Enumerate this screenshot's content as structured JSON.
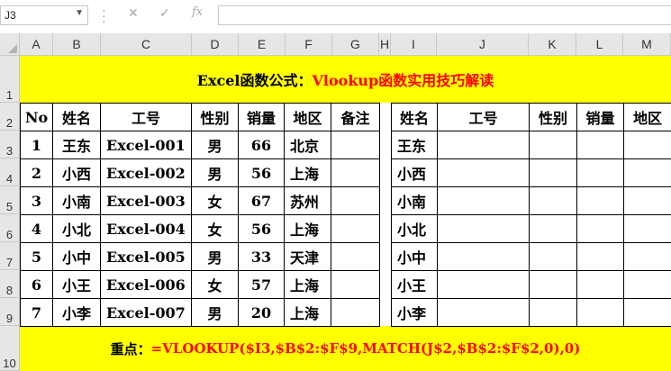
{
  "formula_bar": {
    "name_box": "J3",
    "cancel_icon": "✕",
    "enter_icon": "✓",
    "fx_label": "fx",
    "formula": ""
  },
  "columns": [
    "A",
    "B",
    "C",
    "D",
    "E",
    "F",
    "G",
    "H",
    "I",
    "J",
    "K",
    "L",
    "M"
  ],
  "rows": [
    "1",
    "2",
    "3",
    "4",
    "5",
    "6",
    "7",
    "8",
    "9",
    "10"
  ],
  "title": {
    "part1": "Excel函数公式：",
    "part2": "Vlookup函数实用技巧解读",
    "color1": "#000000",
    "color2": "#ff0000"
  },
  "left_table": {
    "headers": [
      "No",
      "姓名",
      "工号",
      "性别",
      "销量",
      "地区",
      "备注"
    ],
    "rows": [
      [
        "1",
        "王东",
        "Excel-001",
        "男",
        "66",
        "北京",
        ""
      ],
      [
        "2",
        "小西",
        "Excel-002",
        "男",
        "56",
        "上海",
        ""
      ],
      [
        "3",
        "小南",
        "Excel-003",
        "女",
        "67",
        "苏州",
        ""
      ],
      [
        "4",
        "小北",
        "Excel-004",
        "女",
        "56",
        "上海",
        ""
      ],
      [
        "5",
        "小中",
        "Excel-005",
        "男",
        "33",
        "天津",
        ""
      ],
      [
        "6",
        "小王",
        "Excel-006",
        "女",
        "57",
        "上海",
        ""
      ],
      [
        "7",
        "小李",
        "Excel-007",
        "男",
        "20",
        "上海",
        ""
      ]
    ]
  },
  "right_table": {
    "headers": [
      "姓名",
      "工号",
      "性别",
      "销量",
      "地区"
    ],
    "names": [
      "王东",
      "小西",
      "小南",
      "小北",
      "小中",
      "小王",
      "小李"
    ]
  },
  "note": {
    "label": "重点：",
    "formula": "=VLOOKUP($I3,$B$2:$F$9,MATCH(J$2,$B$2:$F$2,0),0)",
    "label_color": "#000000",
    "formula_color": "#ff0000"
  },
  "colors": {
    "highlight": "#ffff00",
    "header_bg": "#e6e6e6"
  }
}
